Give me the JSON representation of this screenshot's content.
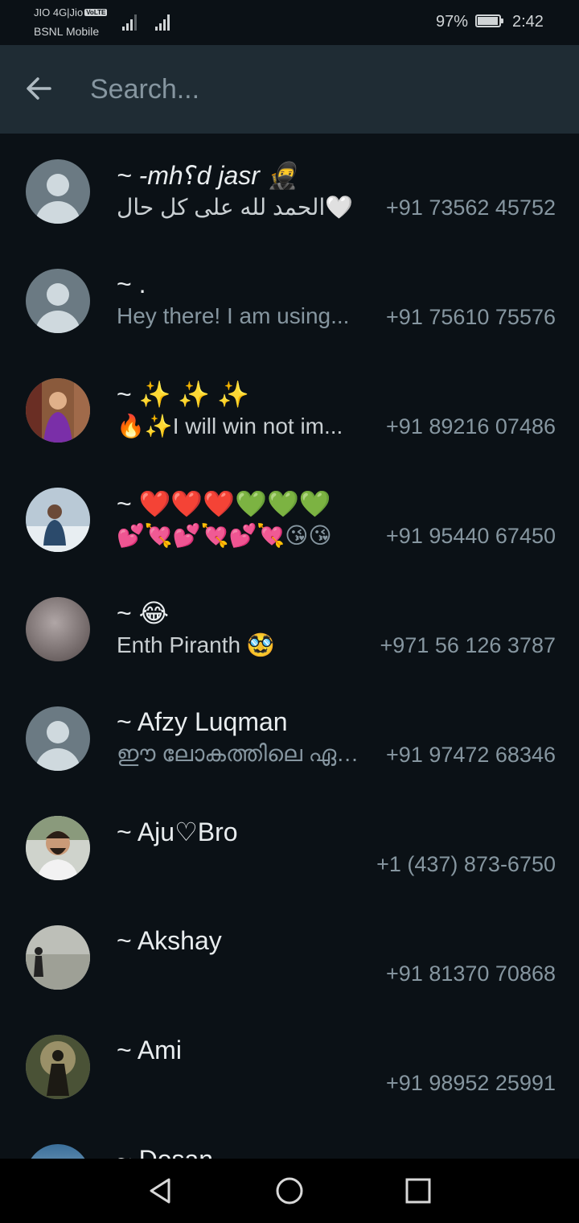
{
  "status_bar": {
    "carrier_line1": "JIO 4G|Jio",
    "volte_badge": "VoLTE",
    "carrier_line2": "BSNL Mobile",
    "battery_percent": "97%",
    "battery_level": 0.97,
    "time": "2:42"
  },
  "search": {
    "placeholder": "Search..."
  },
  "contacts": [
    {
      "name": "~ -mh⸮d jasr 🥷",
      "about": "الحمد لله على كل حال🤍",
      "phone": "+91 73562 45752"
    },
    {
      "name": "~ .",
      "about": "Hey there! I am using...",
      "phone": "+91 75610 75576"
    },
    {
      "name": "~ ✨ ✨ ✨",
      "about": "🔥✨I will win not im...",
      "phone": "+91 89216 07486"
    },
    {
      "name": "~ ❤️❤️❤️💚💚💚",
      "about": "💕💘💕💘💕💘😘😘",
      "phone": "+91 95440 67450"
    },
    {
      "name": "~ 😂",
      "about": "Enth Piranth 🥸",
      "phone": "+971 56 126 3787"
    },
    {
      "name": "~ Afzy Luqman",
      "about": "ഈ ലോകത്തിലെ ഏറ്റ...",
      "phone": "+91 97472 68346"
    },
    {
      "name": "~ Aju♡Bro",
      "about": "",
      "phone": "+1 (437) 873-6750"
    },
    {
      "name": "~ Akshay",
      "about": "",
      "phone": "+91 81370 70868"
    },
    {
      "name": "~ Ami",
      "about": "",
      "phone": "+91 98952 25991"
    },
    {
      "name": "~ Dosan",
      "about": "",
      "phone": ""
    }
  ],
  "icons": {
    "back": "arrow-back-icon",
    "nav_back": "triangle-back-icon",
    "nav_home": "circle-home-icon",
    "nav_recents": "square-recents-icon"
  },
  "colors": {
    "background": "#0b1116",
    "header": "#1f2c34",
    "primary_text": "#e9edef",
    "secondary_text": "#8696a0"
  }
}
